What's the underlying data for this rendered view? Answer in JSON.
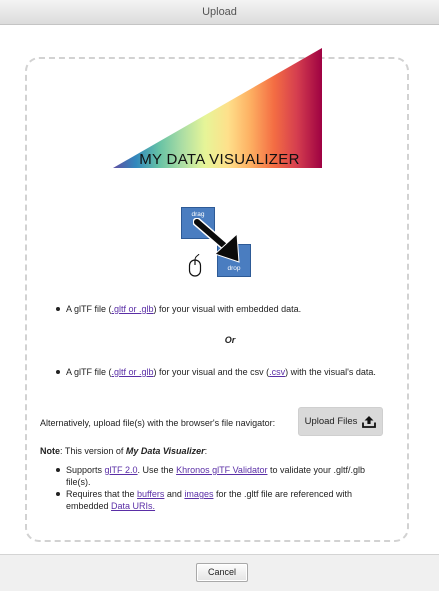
{
  "window": {
    "title": "Upload"
  },
  "app": {
    "title": "MY DATA VISUALIZER"
  },
  "graphic": {
    "drag_label": "drag",
    "drop_label": "drop",
    "gradient_colors": [
      "#5e4fa2",
      "#3288bd",
      "#66c2a5",
      "#abdda4",
      "#e6f598",
      "#fee08b",
      "#fdae61",
      "#f46d43",
      "#d53e4f",
      "#9e0142"
    ],
    "box_color": "#4a7dc0"
  },
  "option1": {
    "prefix": "A glTF file (",
    "link": ".gltf or .glb",
    "suffix": ") for your visual with embedded data."
  },
  "or_label": "Or",
  "option2": {
    "prefix": "A glTF file (",
    "link1": ".gltf or .glb",
    "middle": ") for your visual and the csv (",
    "link2": ".csv",
    "suffix": ") with the visual's data."
  },
  "alternative": {
    "text": "Alternatively, upload file(s) with the browser's file navigator:",
    "button_label": "Upload Files",
    "button_icon": "upload-icon"
  },
  "note": {
    "label": "Note",
    "text_prefix": ": This version of ",
    "app_name": "My Data Visualizer",
    "text_suffix": ":"
  },
  "requirements": [
    {
      "prefix": "Supports ",
      "link1": "glTF 2.0",
      "middle": ". Use the ",
      "link2": "Khronos glTF Validator",
      "suffix": " to validate your .gltf/.glb file(s)."
    },
    {
      "prefix": "Requires that the ",
      "link1": "buffers",
      "middle": " and ",
      "link2": "images",
      "middle2": " for the .gltf file are referenced with embedded ",
      "link3": "Data URIs."
    }
  ],
  "footer": {
    "cancel_label": "Cancel"
  }
}
